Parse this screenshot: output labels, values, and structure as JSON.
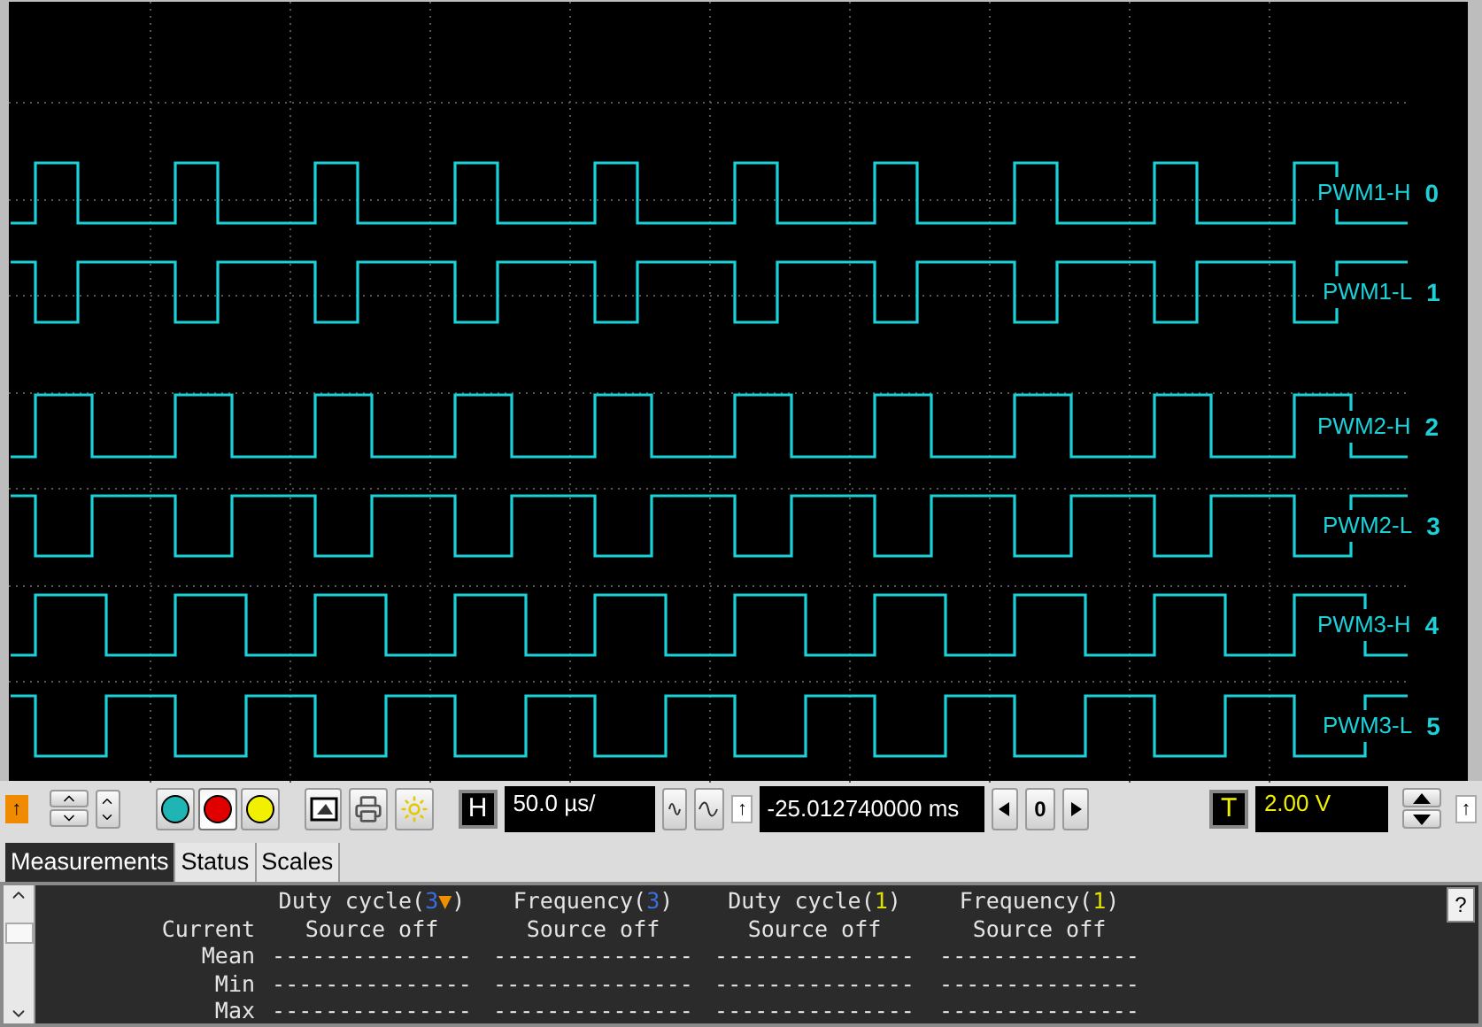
{
  "traces": [
    {
      "label": "PWM1-H",
      "number": "0"
    },
    {
      "label": "PWM1-L",
      "number": "1"
    },
    {
      "label": "PWM2-H",
      "number": "2"
    },
    {
      "label": "PWM2-L",
      "number": "3"
    },
    {
      "label": "PWM3-H",
      "number": "4"
    },
    {
      "label": "PWM3-L",
      "number": "5"
    }
  ],
  "toolbar": {
    "run_marker": "↑",
    "channel_buttons": [
      {
        "color": "#1fb5b5",
        "selected": false
      },
      {
        "color": "#e00000",
        "selected": true
      },
      {
        "color": "#f0f000",
        "selected": false
      }
    ],
    "horizontal_mark": "H",
    "timebase": "50.0 µs/",
    "trigger_edge": "↑",
    "offset": "-25.012740000 ms",
    "offset_step": "0",
    "trigger_mark": "T",
    "trigger_level": "2.00 V",
    "level_marker": "↑"
  },
  "tabs": [
    {
      "label": "Measurements",
      "selected": true
    },
    {
      "label": "Status",
      "selected": false
    },
    {
      "label": "Scales",
      "selected": false
    }
  ],
  "measurements": {
    "columns": [
      [
        {
          "text": "Duty cycle("
        },
        {
          "text": "3",
          "color": "#3b6fe0"
        },
        {
          "text": "▼",
          "color": "#f09000"
        },
        {
          "text": ")"
        }
      ],
      [
        {
          "text": "Frequency("
        },
        {
          "text": "3",
          "color": "#3b6fe0"
        },
        {
          "text": ")"
        }
      ],
      [
        {
          "text": "Duty cycle("
        },
        {
          "text": "1",
          "color": "#e0e000"
        },
        {
          "text": ")"
        }
      ],
      [
        {
          "text": "Frequency("
        },
        {
          "text": "1",
          "color": "#e0e000"
        },
        {
          "text": ")"
        }
      ]
    ],
    "rows": [
      {
        "label": "Current",
        "values": [
          "Source off",
          "Source off",
          "Source off",
          "Source off"
        ]
      },
      {
        "label": "Mean",
        "values": [
          "---------------",
          "---------------",
          "---------------",
          "---------------"
        ]
      },
      {
        "label": "Min",
        "values": [
          "---------------",
          "---------------",
          "---------------",
          "---------------"
        ]
      },
      {
        "label": "Max",
        "values": [
          "---------------",
          "---------------",
          "---------------",
          "---------------"
        ]
      }
    ],
    "help": "?"
  }
}
